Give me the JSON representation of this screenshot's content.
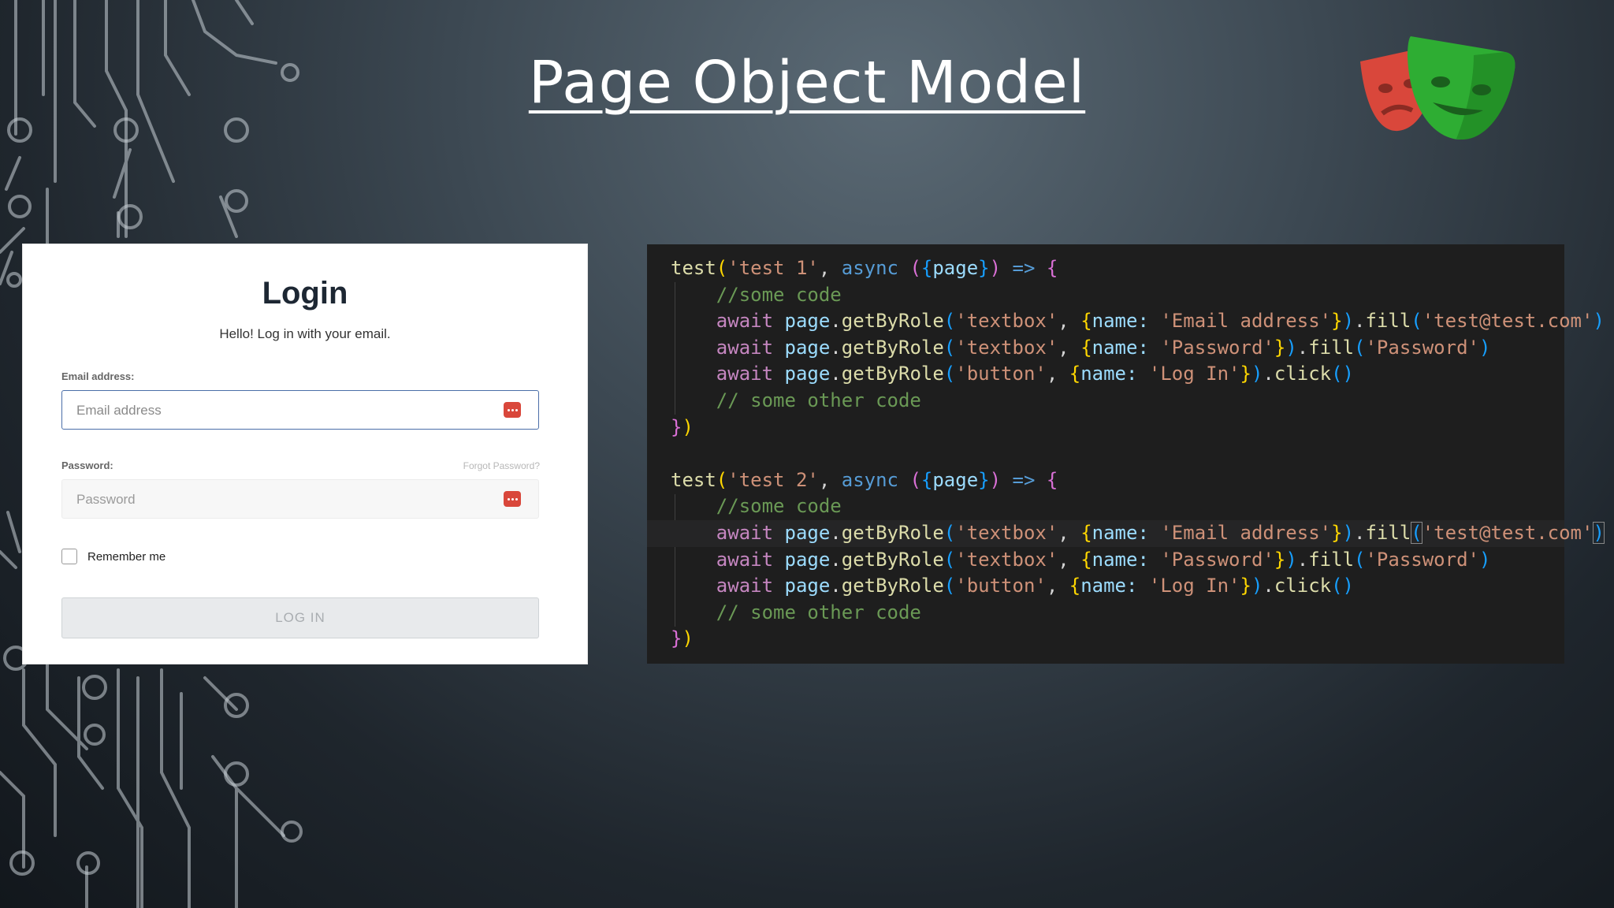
{
  "slide": {
    "title": "Page Object Model"
  },
  "login": {
    "title": "Login",
    "subtitle": "Hello! Log in with your email.",
    "email_label": "Email address:",
    "email_placeholder": "Email address",
    "password_label": "Password:",
    "forgot_link": "Forgot Password?",
    "password_placeholder": "Password",
    "remember_label": "Remember me",
    "submit_label": "LOG IN"
  },
  "code": {
    "test1": {
      "name": "'test 1'",
      "comment1": "//some code",
      "email_fill_text": "'test@test.com'",
      "comment2": "// some other code"
    },
    "test2": {
      "name": "'test 2'",
      "comment1": "//some code",
      "email_fill_text": "'test@test.com'",
      "comment2": "// some other code"
    },
    "tokens": {
      "test": "test",
      "async": "async",
      "page": "page",
      "await": "await",
      "getByRole": "getByRole",
      "fill": "fill",
      "click": "click",
      "textbox": "'textbox'",
      "button": "'button'",
      "name_key": "name:",
      "email_name": "'Email address'",
      "password_name": "'Password'",
      "login_name": "'Log In'",
      "password_value": "'Password'"
    }
  },
  "colors": {
    "keyword": "#c586c0",
    "function": "#dcdcaa",
    "string": "#ce9178",
    "comment": "#6a9955",
    "variable": "#9cdcfe",
    "arrow": "#569cd6",
    "bracket1": "#ffd700",
    "bracket2": "#da70d6",
    "bracket3": "#179fff",
    "logo_red": "#d9473b",
    "logo_green": "#2ead33"
  },
  "icons": [
    "circuit-board-decoration",
    "playwright-logo-icon",
    "password-manager-key-icon"
  ]
}
